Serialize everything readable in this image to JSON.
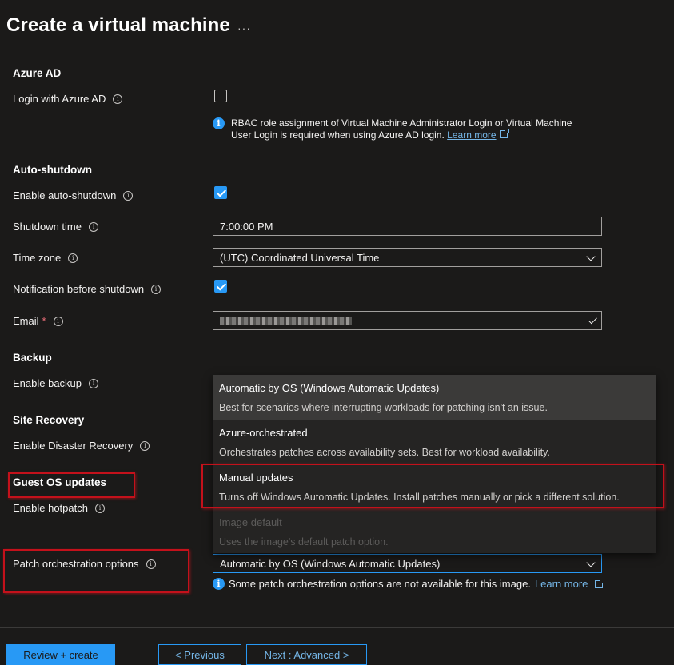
{
  "page": {
    "title": "Create a virtual machine",
    "more": "···"
  },
  "azure_ad": {
    "section": "Azure AD",
    "login_label": "Login with Azure AD",
    "login_checked": false,
    "rbac_note": "RBAC role assignment of Virtual Machine Administrator Login or Virtual Machine User Login is required when using Azure AD login.",
    "learn_more": "Learn more"
  },
  "auto_shutdown": {
    "section": "Auto-shutdown",
    "enable_label": "Enable auto-shutdown",
    "enable_checked": true,
    "time_label": "Shutdown time",
    "time_value": "7:00:00 PM",
    "zone_label": "Time zone",
    "zone_value": "(UTC) Coordinated Universal Time",
    "notify_label": "Notification before shutdown",
    "notify_checked": true,
    "email_label": "Email",
    "email_required": "*"
  },
  "backup": {
    "section": "Backup",
    "enable_label": "Enable backup"
  },
  "site_recovery": {
    "section": "Site Recovery",
    "enable_label": "Enable Disaster Recovery"
  },
  "guest_os": {
    "section": "Guest OS updates",
    "hotpatch_label": "Enable hotpatch",
    "patch_label": "Patch orchestration options",
    "patch_value": "Automatic by OS (Windows Automatic Updates)",
    "hint": "Some patch orchestration options are not available for this image.",
    "hint_link": "Learn more"
  },
  "dropdown": {
    "options": [
      {
        "title": "Automatic by OS (Windows Automatic Updates)",
        "desc": "Best for scenarios where interrupting workloads for patching isn't an issue.",
        "state": "selected"
      },
      {
        "title": "Azure-orchestrated",
        "desc": "Orchestrates patches across availability sets. Best for workload availability.",
        "state": "normal"
      },
      {
        "title": "Manual updates",
        "desc": "Turns off Windows Automatic Updates. Install patches manually or pick a different solution.",
        "state": "normal"
      },
      {
        "title": "Image default",
        "desc": "Uses the image's default patch option.",
        "state": "disabled"
      }
    ]
  },
  "footer": {
    "review_create": "Review + create",
    "previous": "< Previous",
    "next": "Next : Advanced >"
  },
  "colors": {
    "accent": "#2899f5",
    "link": "#75b6e7",
    "annotation": "#c4111b",
    "background": "#1b1a19"
  }
}
